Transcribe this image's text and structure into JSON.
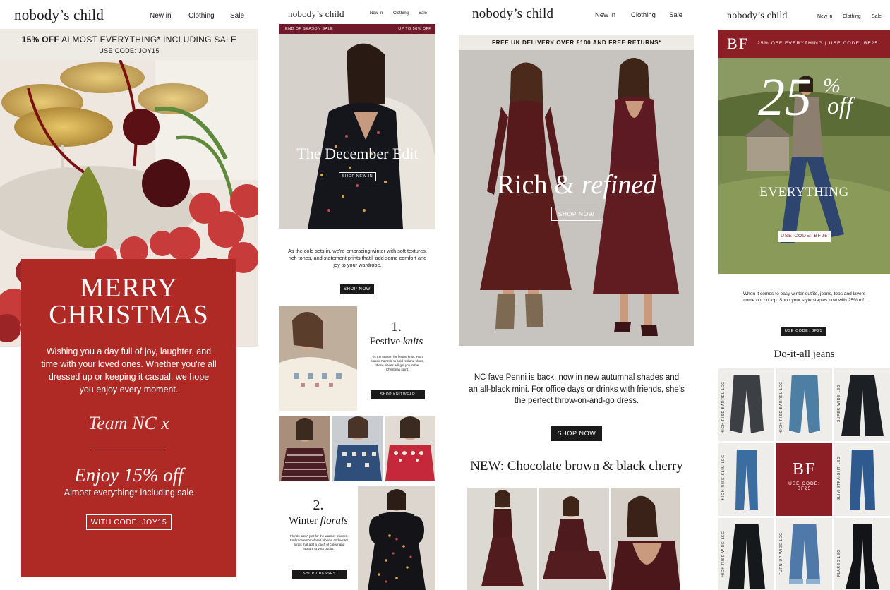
{
  "col1": {
    "logo": "nobody’s child",
    "nav": [
      "New in",
      "Clothing",
      "Sale"
    ],
    "promo_bold": "15% OFF",
    "promo_rest": " ALMOST EVERYTHING* INCLUDING SALE",
    "promo_code": "USE CODE: JOY15",
    "card": {
      "title_line1": "MERRY",
      "title_line2": "CHRISTMAS",
      "body": "Wishing you a day full of joy, laughter, and time with your loved ones. Whether you're all dressed up or keeping it casual, we hope you enjoy every moment.",
      "signature": "Team NC x",
      "offer_title": "Enjoy 15% off",
      "offer_sub": "Almost everything* including sale",
      "button": "WITH CODE: JOY15"
    },
    "colors": {
      "card": "#b02a25",
      "promo_bg": "#eeeae4"
    }
  },
  "col2": {
    "logo": "nobody’s child",
    "nav": [
      "New in",
      "Clothing",
      "Sale"
    ],
    "banner_left": "END OF SEASON SALE",
    "banner_right": "UP TO 50% OFF",
    "hero_title": "The December Edit",
    "hero_button": "SHOP NEW IN",
    "intro": "As the cold sets in, we're embracing winter with soft textures, rich tones, and statement prints that'll add some comfort and joy to your wardrobe.",
    "intro_button": "SHOP NOW",
    "sec1": {
      "number": "1.",
      "title_plain": "Festive ",
      "title_italic": "knits",
      "body": "'Tis the season for festive knits. From classic Fair Isle to bold red and blues, these pieces will get you in the Christmas spirit.",
      "button": "SHOP KNITWEAR"
    },
    "sec2": {
      "number": "2.",
      "title_plain": "Winter ",
      "title_italic": "florals",
      "body": "Florals aren't just for the warmer months. Embrace embroidered blooms and winter florals that add a touch of colour and texture to your outfits.",
      "button": "SHOP DRESSES"
    },
    "colors": {
      "banner": "#6e1a2b"
    }
  },
  "col3": {
    "logo": "nobody’s child",
    "nav": [
      "New in",
      "Clothing",
      "Sale"
    ],
    "promo": "FREE UK DELIVERY OVER £100 AND FREE RETURNS*",
    "hero_title_plain": "Rich & ",
    "hero_title_italic": "refined",
    "hero_button": "SHOP NOW",
    "body": "NC fave Penni is back, now in new autumnal shades and an all-black mini. For office days or drinks with friends, she’s the perfect throw-on-and-go dress.",
    "button": "SHOP NOW",
    "section_title": "NEW: Chocolate brown & black cherry",
    "colors": {
      "dress": "#5b1c1c"
    }
  },
  "col4": {
    "logo": "nobody’s child",
    "nav": [
      "New in",
      "Clothing",
      "Sale"
    ],
    "bf_mark": "BF",
    "banner_text": "25% OFF EVERYTHING | USE CODE: BF25",
    "hero_pct": "25",
    "hero_pct_sign": "%",
    "hero_off": "off",
    "hero_everything": "EVERYTHING",
    "hero_code": "USE CODE: BF25",
    "body": "When it comes to easy winter outfits, jeans, tops and layers come out on top. Shop your style staples now with 25% off.",
    "body_button": "USE CODE: BF25",
    "section_title": "Do-it-all jeans",
    "tile_bf": "BF",
    "tile_code_line1": "USE CODE:",
    "tile_code_line2": "BF25",
    "jeans_labels": [
      "HIGH RISE BARREL LEG",
      "HIGH RISE BARREL LEG",
      "SUPER WIDE LEG",
      "HIGH RISE SLIM LEG",
      "SLIM STRAIGHT LEG",
      "HIGH RISE WIDE LEG",
      "TURN UP WIDE LEG",
      "FLARED LEG"
    ],
    "colors": {
      "bf": "#8c1f25"
    }
  }
}
